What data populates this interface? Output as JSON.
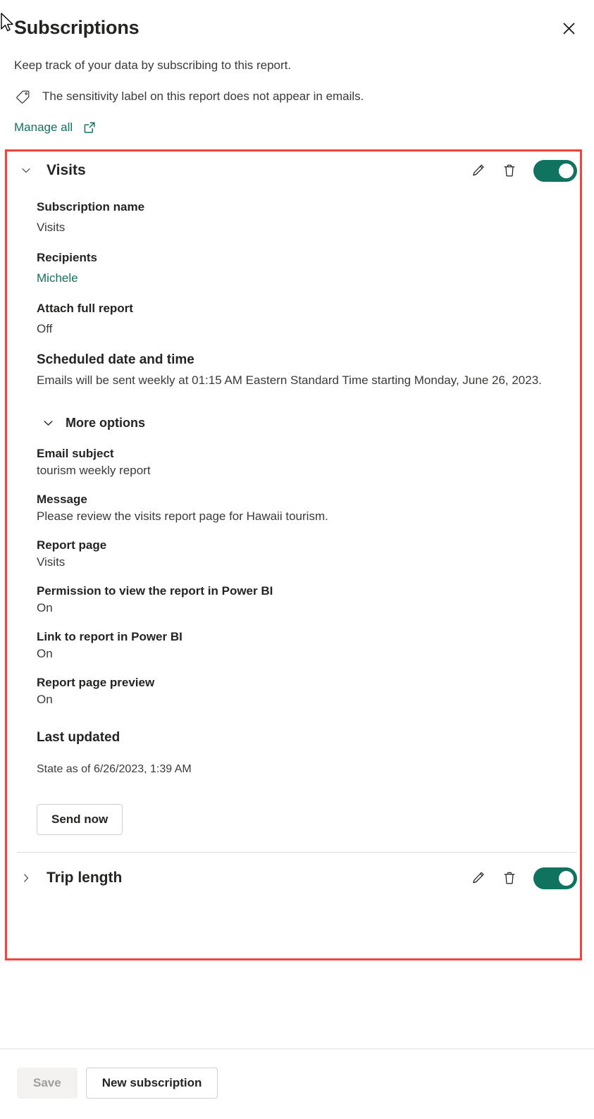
{
  "header": {
    "title": "Subscriptions",
    "close_icon": "close-icon",
    "subtitle": "Keep track of your data by subscribing to this report.",
    "sensitivity_icon": "tag-icon",
    "sensitivity_text": "The sensitivity label on this report does not appear in emails.",
    "manage_all_label": "Manage all",
    "manage_all_icon": "external-link-icon"
  },
  "subscriptions": [
    {
      "name": "Visits",
      "expanded": true,
      "chevron_icon": "chevron-down-icon",
      "edit_icon": "pencil-icon",
      "delete_icon": "trash-icon",
      "toggle_state": "on",
      "fields": [
        {
          "label": "Subscription name",
          "value": "Visits"
        },
        {
          "label": "Recipients",
          "value": "Michele",
          "is_link": true
        },
        {
          "label": "Attach full report",
          "value": "Off"
        }
      ],
      "schedule": {
        "label": "Scheduled date and time",
        "value": "Emails will be sent weekly at 01:15 AM Eastern Standard Time starting Monday, June 26, 2023."
      },
      "more_options": {
        "label": "More options",
        "chevron_icon": "chevron-down-icon",
        "expanded": true
      },
      "more_fields": [
        {
          "label": "Email subject",
          "value": "tourism weekly report"
        },
        {
          "label": "Message",
          "value": "Please review the visits report page for Hawaii tourism."
        },
        {
          "label": "Report page",
          "value": "Visits"
        },
        {
          "label": "Permission to view the report in Power BI",
          "value": "On"
        },
        {
          "label": "Link to report in Power BI",
          "value": "On"
        },
        {
          "label": "Report page preview",
          "value": "On"
        }
      ],
      "last_updated": {
        "label": "Last updated",
        "value": "State as of 6/26/2023, 1:39 AM"
      },
      "send_now_label": "Send now"
    },
    {
      "name": "Trip length",
      "expanded": false,
      "chevron_icon": "chevron-right-icon",
      "edit_icon": "pencil-icon",
      "delete_icon": "trash-icon",
      "toggle_state": "on"
    }
  ],
  "footer": {
    "save_label": "Save",
    "save_disabled": true,
    "new_subscription_label": "New subscription"
  },
  "colors": {
    "accent_teal": "#0f7360",
    "highlight_red": "#f4433c",
    "text_primary": "#252423",
    "text_secondary": "#3b3a39",
    "border": "#d2d0ce",
    "disabled_bg": "#f3f2f1"
  }
}
